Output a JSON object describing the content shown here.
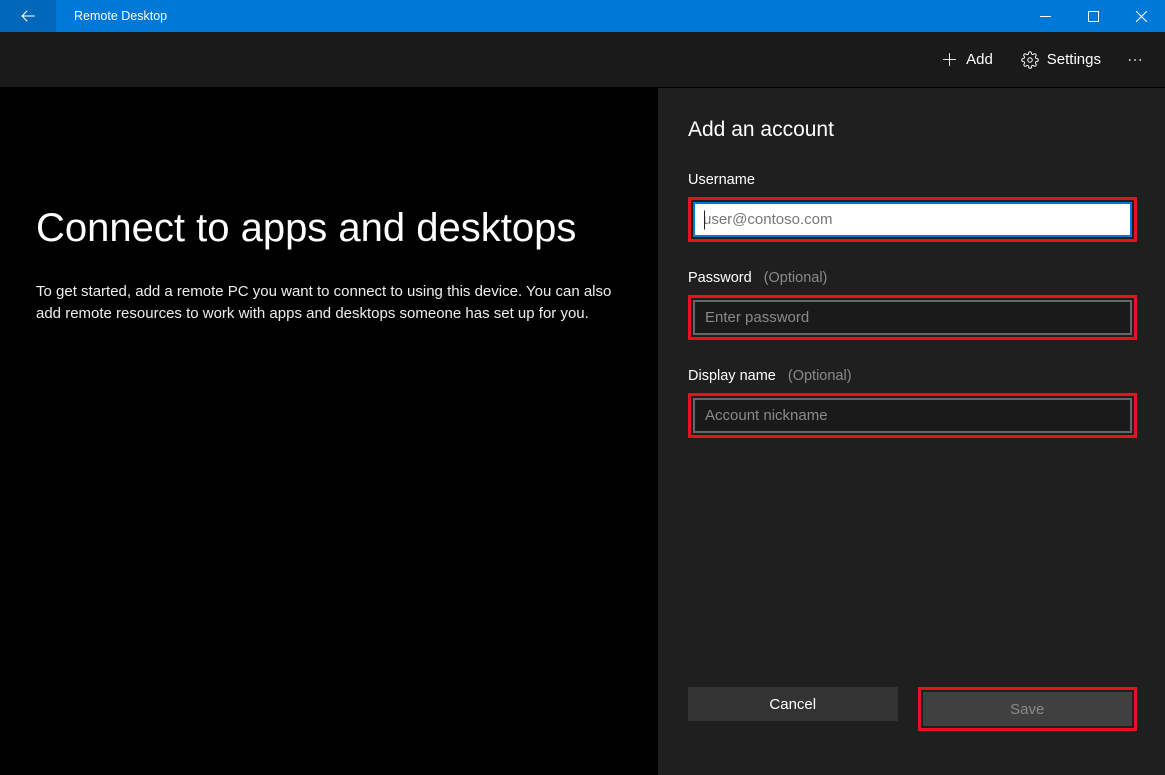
{
  "titlebar": {
    "title": "Remote Desktop"
  },
  "commandbar": {
    "add_label": "Add",
    "settings_label": "Settings"
  },
  "main": {
    "title": "Connect to apps and desktops",
    "paragraph": "To get started, add a remote PC you want to connect to using this device. You can also add remote resources to work with apps and desktops someone has set up for you."
  },
  "panel": {
    "title": "Add an account",
    "username_label": "Username",
    "username_placeholder": "user@contoso.com",
    "username_value": "",
    "password_label": "Password",
    "password_opt": "(Optional)",
    "password_placeholder": "Enter password",
    "password_value": "",
    "display_label": "Display name",
    "display_opt": "(Optional)",
    "display_placeholder": "Account nickname",
    "display_value": "",
    "cancel_label": "Cancel",
    "save_label": "Save"
  },
  "icons": {
    "back": "back-arrow",
    "plus": "plus",
    "gear": "gear",
    "more": "ellipsis",
    "minimize": "minimize",
    "maximize": "maximize",
    "close": "close"
  },
  "colors": {
    "accent": "#0078d7",
    "highlight": "#e81123"
  }
}
